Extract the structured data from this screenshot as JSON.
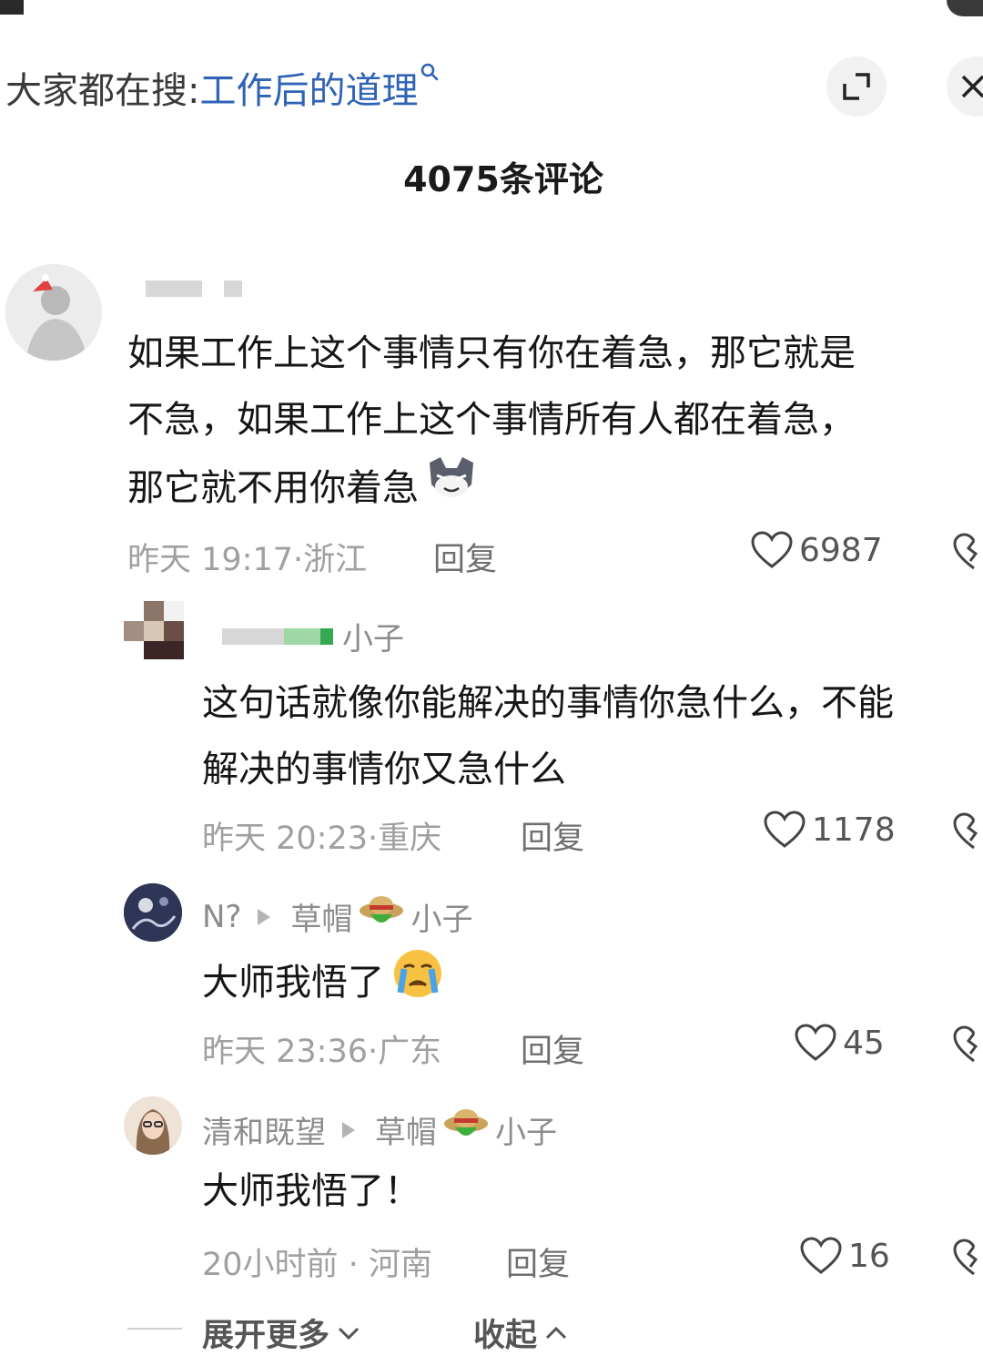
{
  "header": {
    "search_prefix": "大家都在搜:",
    "search_query": "工作后的道理",
    "comment_count": "4075条评论"
  },
  "comments": [
    {
      "username": "",
      "text_lines": [
        "如果工作上这个事情只有你在着急，那它就是",
        "不急，如果工作上这个事情所有人都在着急，",
        "那它就不用你着急"
      ],
      "time": "昨天 19:17",
      "location": "浙江",
      "reply_label": "回复",
      "likes": "6987",
      "emoji_icon": "wolf-emoji-icon"
    },
    {
      "username_suffix": "小子",
      "text_lines": [
        "这句话就像你能解决的事情你急什么，不能",
        "解决的事情你又急什么"
      ],
      "time": "昨天 20:23",
      "location": "重庆",
      "reply_label": "回复",
      "likes": "1178"
    },
    {
      "username": "N?",
      "reply_to_a": "草帽",
      "reply_to_b": "小子",
      "text": "大师我悟了",
      "time": "昨天 23:36",
      "location": "广东",
      "reply_label": "回复",
      "likes": "45",
      "emoji_icon": "crying-face-icon"
    },
    {
      "username": "清和既望",
      "reply_to_a": "草帽",
      "reply_to_b": "小子",
      "text": "大师我悟了！",
      "time": "20小时前",
      "location": "河南",
      "reply_label": "回复",
      "likes": "16"
    }
  ],
  "footer": {
    "expand_more": "展开更多",
    "collapse": "收起"
  }
}
